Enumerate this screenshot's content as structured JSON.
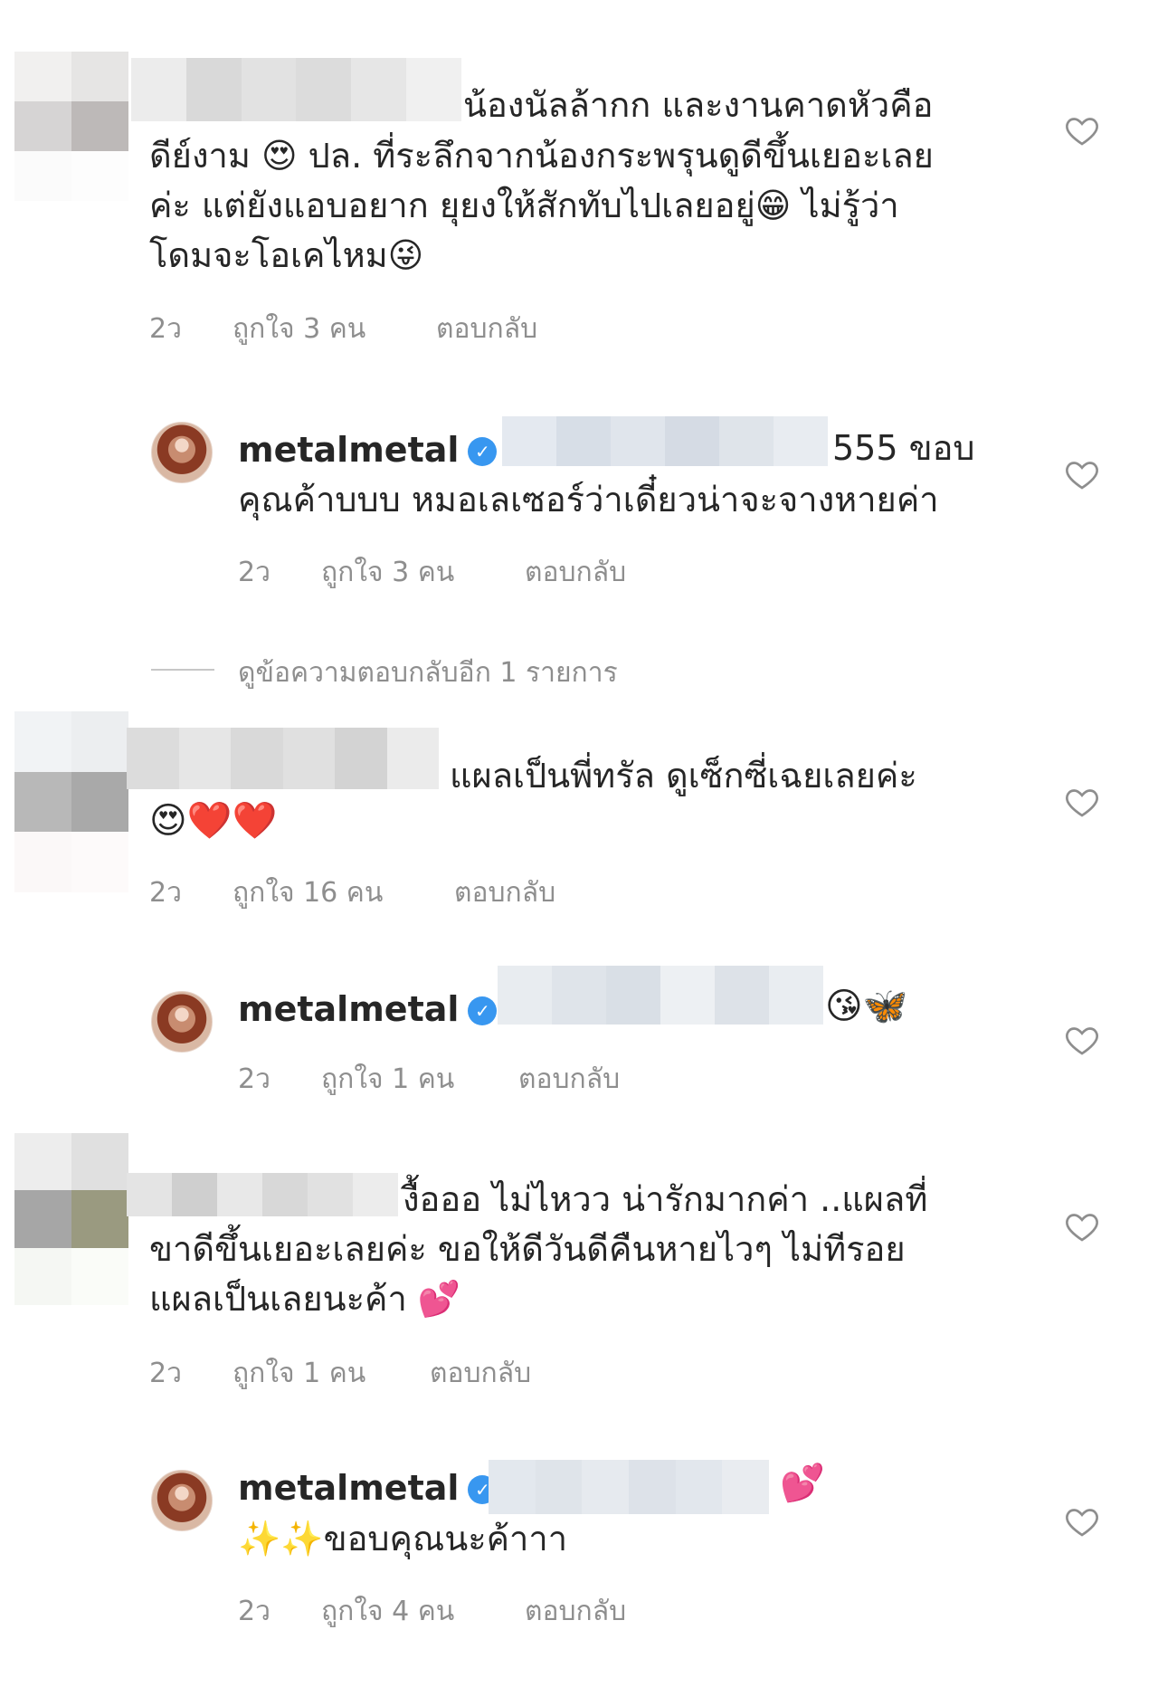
{
  "colors": {
    "text": "#262626",
    "meta": "#8e8e8e",
    "verified": "#3897f0",
    "blur_light": "#e4e4e4",
    "blur_dark": "#c2c2c2",
    "blur_reply": "#dde4ee"
  },
  "comments": [
    {
      "text_lines": [
        "น้องนัลล้ากก และงานคาดหัวคือ",
        "ดีย์งาม 😍 ปล. ที่ระลึกจากน้องกระพรุนดูดีขึ้นเยอะเลย",
        "ค่ะ แต่ยังแอบอยาก ยุยงให้สักทับไปเลยอยู่😁 ไม่รู้ว่า",
        "โดมจะโอเคไหม😜"
      ],
      "time": "2ว",
      "likes": "ถูกใจ 3 คน",
      "reply": "ตอบกลับ",
      "heart_icon": "heart-outline-icon"
    },
    {
      "username": "metalmetal",
      "verified_icon": "verified-badge-icon",
      "text_lines": [
        "555 ขอบ",
        "คุณค้าบบบ หมอเลเซอร์ว่าเดี๋ยวน่าจะจางหายค่า"
      ],
      "time": "2ว",
      "likes": "ถูกใจ 3 คน",
      "reply": "ตอบกลับ"
    },
    {
      "view_more": "ดูข้อความตอบกลับอีก 1 รายการ"
    },
    {
      "text_lines": [
        "แผลเป็นพี่ทรัล ดูเซ็กซี่เฉยเลยค่ะ",
        "😍❤️❤️"
      ],
      "time": "2ว",
      "likes": "ถูกใจ 16 คน",
      "reply": "ตอบกลับ"
    },
    {
      "username": "metalmetal",
      "text_lines": [
        "😘🦋"
      ],
      "time": "2ว",
      "likes": "ถูกใจ 1 คน",
      "reply": "ตอบกลับ"
    },
    {
      "text_lines": [
        "งื้อออ ไม่ไหวว น่ารักมากค่า ..แผลที่",
        "ขาดีขึ้นเยอะเลยค่ะ ขอให้ดีวันดีคืนหายไวๆ ไม่ทีรอย",
        "แผลเป็นเลยนะค้า 💕"
      ],
      "time": "2ว",
      "likes": "ถูกใจ 1 คน",
      "reply": "ตอบกลับ"
    },
    {
      "username": "metalmetal",
      "text_lines": [
        "💕",
        "✨✨ขอบคุณนะค้าาา"
      ],
      "time": "2ว",
      "likes": "ถูกใจ 4 คน",
      "reply": "ตอบกลับ"
    }
  ]
}
